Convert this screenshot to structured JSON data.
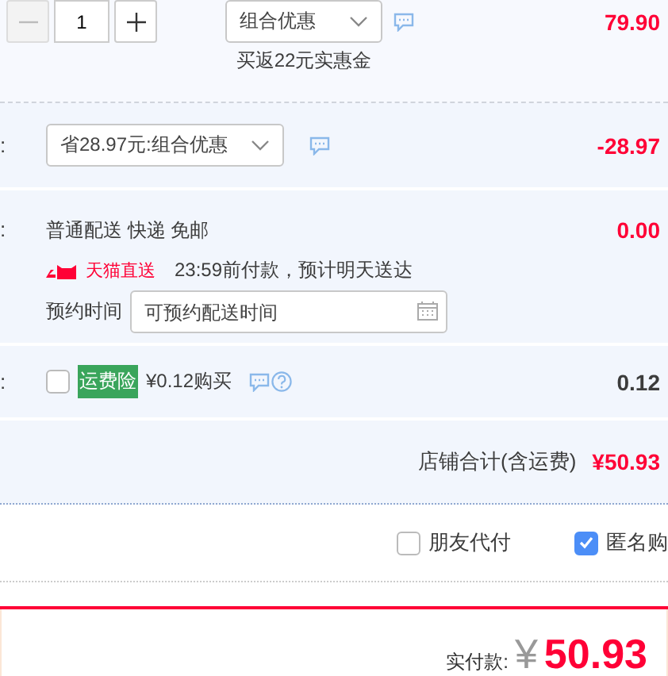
{
  "product_row": {
    "quantity": {
      "value": "1",
      "minus_disabled": true
    },
    "promo_select": "组合优惠",
    "promo_note": "买返22元实惠金",
    "price": "79.90"
  },
  "discount_row": {
    "label": ":",
    "select": "省28.97元:组合优惠",
    "amount": "-28.97"
  },
  "shipping_row": {
    "label": ":",
    "method": "普通配送 快递 免邮",
    "badge": "天猫直送",
    "delivery_note": "23:59前付款，预计明天送达",
    "schedule_label": "预约时间",
    "schedule_placeholder": "可预约配送时间",
    "amount": "0.00"
  },
  "insurance_row": {
    "label": ":",
    "checked": false,
    "badge": "运费险",
    "offer": "¥0.12购买",
    "amount": "0.12"
  },
  "store_total": {
    "label": "店铺合计(含运费)",
    "amount": "¥50.93"
  },
  "options": [
    {
      "label": "朋友代付",
      "checked": false
    },
    {
      "label": "匿名购",
      "checked": true
    }
  ],
  "payment": {
    "label": "实付款:",
    "currency": "¥",
    "amount": "50.93"
  }
}
